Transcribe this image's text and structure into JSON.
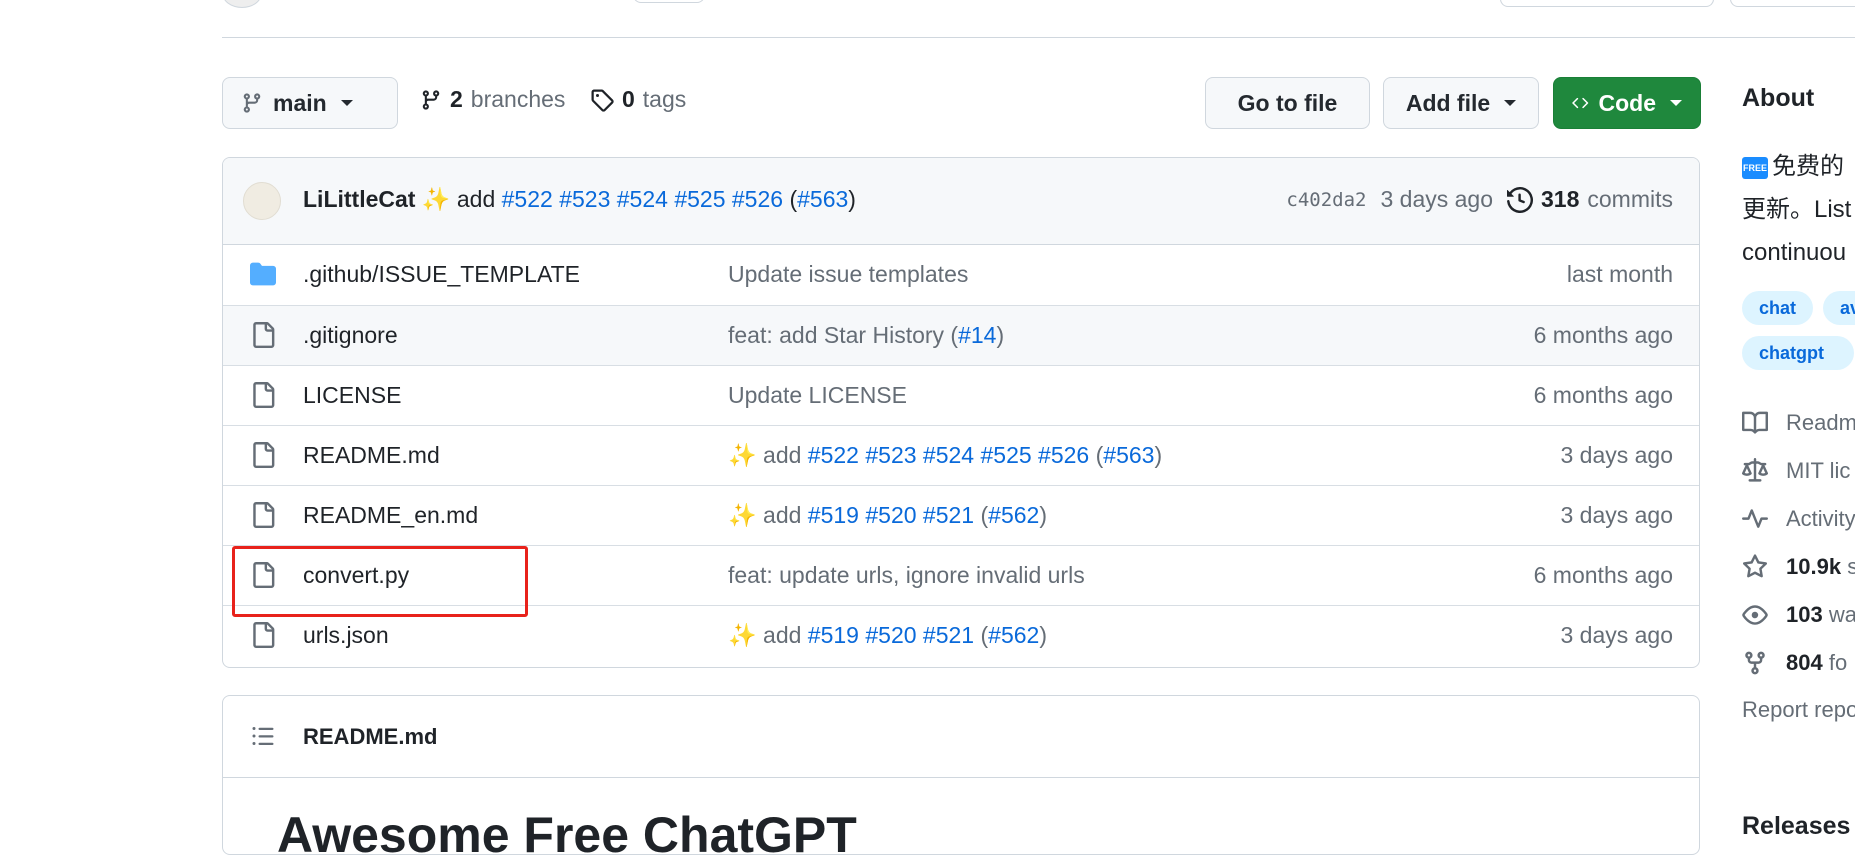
{
  "toolbar": {
    "branch": "main",
    "branches_count": "2",
    "branches_label": "branches",
    "tags_count": "0",
    "tags_label": "tags",
    "go_to_file": "Go to file",
    "add_file": "Add file",
    "code": "Code"
  },
  "latest_commit": {
    "author": "LiLittleCat",
    "emoji": "✨",
    "msg_prefix": "add",
    "issues": [
      "#522",
      "#523",
      "#524",
      "#525",
      "#526"
    ],
    "pr": "#563",
    "sha": "c402da2",
    "time": "3 days ago",
    "commits_count": "318",
    "commits_label": "commits"
  },
  "files": [
    {
      "type": "folder",
      "name": ".github/ISSUE_TEMPLATE",
      "message": "Update issue templates",
      "time": "last month"
    },
    {
      "type": "file",
      "name": ".gitignore",
      "message": "feat: add Star History (",
      "message_link": "#14",
      "message_suffix": ")",
      "time": "6 months ago"
    },
    {
      "type": "file",
      "name": "LICENSE",
      "message": "Update LICENSE",
      "time": "6 months ago"
    },
    {
      "type": "file",
      "name": "README.md",
      "emoji": "✨",
      "message": "add",
      "issues": [
        "#522",
        "#523",
        "#524",
        "#525",
        "#526"
      ],
      "pr": "#563",
      "time": "3 days ago"
    },
    {
      "type": "file",
      "name": "README_en.md",
      "emoji": "✨",
      "message": "add",
      "issues": [
        "#519",
        "#520",
        "#521"
      ],
      "pr": "#562",
      "time": "3 days ago"
    },
    {
      "type": "file",
      "name": "convert.py",
      "message": "feat: update urls, ignore invalid urls",
      "time": "6 months ago"
    },
    {
      "type": "file",
      "name": "urls.json",
      "emoji": "✨",
      "message": "add",
      "issues": [
        "#519",
        "#520",
        "#521"
      ],
      "pr": "#562",
      "time": "3 days ago"
    }
  ],
  "readme": {
    "title": "README.md",
    "heading": "Awesome Free ChatGPT"
  },
  "about": {
    "title": "About",
    "badge": "FREE",
    "desc_line1": "免费的",
    "desc_line2": "更新。List",
    "desc_line3": "continuou",
    "topics": [
      "chat",
      "av",
      "chatgpt"
    ],
    "readme": "Readm",
    "license": "MIT lic",
    "activity": "Activity",
    "stars_count": "10.9k",
    "stars_label": "s",
    "watch_count": "103",
    "watch_label": "wa",
    "forks_count": "804",
    "forks_label": "fo",
    "report": "Report repo",
    "releases": "Releases"
  }
}
